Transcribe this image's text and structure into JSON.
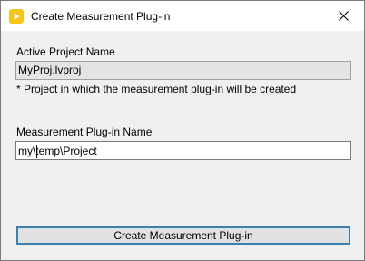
{
  "window": {
    "title": "Create Measurement Plug-in",
    "icon": "labview-run-arrow-icon",
    "close_icon": "close-icon",
    "accent_color": "#f5c518"
  },
  "project": {
    "label": "Active Project Name",
    "value": "MyProj.lvproj",
    "note": "* Project in which the measurement plug-in will be created"
  },
  "plugin": {
    "label": "Measurement Plug-in Name",
    "value": "my\\temp\\Project"
  },
  "actions": {
    "create_label": "Create Measurement Plug-in"
  }
}
